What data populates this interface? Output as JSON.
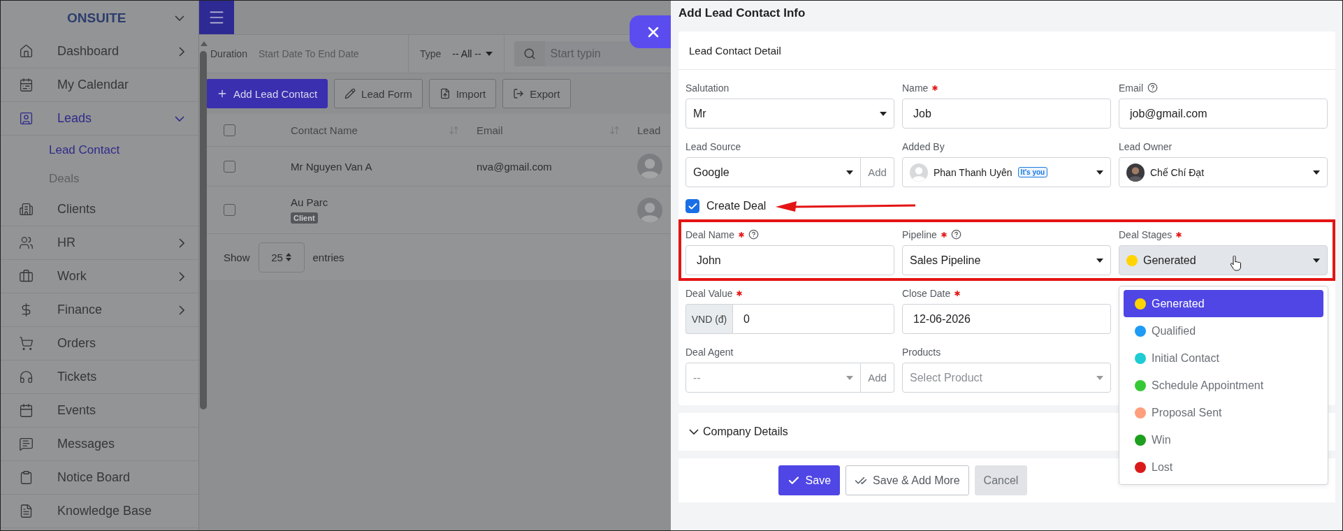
{
  "sidebar": {
    "brand": "ONSUITE",
    "items": [
      {
        "label": "Dashboard",
        "kind": "menu",
        "expanded": false,
        "selected": false
      },
      {
        "label": "My Calendar",
        "kind": "link",
        "selected": false
      },
      {
        "label": "Leads",
        "kind": "menu",
        "expanded": true,
        "selected": true,
        "children": [
          {
            "label": "Lead Contact",
            "selected": true
          },
          {
            "label": "Deals",
            "selected": false
          }
        ]
      },
      {
        "label": "Clients",
        "kind": "link",
        "selected": false
      },
      {
        "label": "HR",
        "kind": "menu",
        "expanded": false,
        "selected": false
      },
      {
        "label": "Work",
        "kind": "menu",
        "expanded": false,
        "selected": false
      },
      {
        "label": "Finance",
        "kind": "menu",
        "expanded": false,
        "selected": false
      },
      {
        "label": "Orders",
        "kind": "link",
        "selected": false
      },
      {
        "label": "Tickets",
        "kind": "link",
        "selected": false
      },
      {
        "label": "Events",
        "kind": "link",
        "selected": false
      },
      {
        "label": "Messages",
        "kind": "link",
        "selected": false
      },
      {
        "label": "Notice Board",
        "kind": "link",
        "selected": false
      },
      {
        "label": "Knowledge Base",
        "kind": "link",
        "selected": false
      }
    ]
  },
  "filters": {
    "duration_label": "Duration",
    "date_placeholder": "Start Date To End Date",
    "type_label": "Type",
    "type_value": "-- All --",
    "search_placeholder": "Start typin"
  },
  "toolbar": [
    {
      "label": "Add Lead Contact",
      "kind": "primary"
    },
    {
      "label": "Lead Form",
      "kind": "outline"
    },
    {
      "label": "Import",
      "kind": "outline"
    },
    {
      "label": "Export",
      "kind": "outline"
    }
  ],
  "table": {
    "all_checked": false,
    "columns": [
      "Contact Name",
      "Email",
      "Lead"
    ],
    "rows": [
      {
        "name": "Mr Nguyen Van A",
        "email": "nva@gmail.com",
        "checked": false
      },
      {
        "name": "Au Parc",
        "badge": "Client",
        "checked": false
      }
    ],
    "footer": {
      "show": "Show",
      "page_size": "25",
      "entries": "entries"
    }
  },
  "panel": {
    "title": "Add Lead Contact Info",
    "section": "Lead Contact Detail",
    "rows": [
      {
        "fields": [
          {
            "kind": "select",
            "label": "Salutation",
            "value": "Mr",
            "required": false,
            "help": false
          },
          {
            "kind": "text",
            "label": "Name",
            "value": "Job",
            "required": true,
            "help": false
          },
          {
            "kind": "text",
            "label": "Email",
            "value": "job@gmail.com",
            "required": false,
            "help": true
          }
        ]
      },
      {
        "fields": [
          {
            "kind": "select_add",
            "label": "Lead Source",
            "value": "Google",
            "button": "Add",
            "required": false,
            "help": false
          },
          {
            "kind": "user_select",
            "label": "Added By",
            "value": "Phan Thanh Uyên",
            "badge": "It's you",
            "required": false,
            "help": false
          },
          {
            "kind": "user_select",
            "label": "Lead Owner",
            "value": "Chế Chí Đạt",
            "required": false,
            "help": false
          }
        ]
      }
    ],
    "create_deal": {
      "label": "Create Deal",
      "checked": true
    },
    "deal_rows": [
      {
        "fields": [
          {
            "kind": "text",
            "label": "Deal Name",
            "value": "John",
            "required": true,
            "help": true
          },
          {
            "kind": "select",
            "label": "Pipeline",
            "value": "Sales Pipeline",
            "required": true,
            "help": true
          },
          {
            "kind": "stage_select",
            "label": "Deal Stages",
            "value": "Generated",
            "color": "#ffd400",
            "required": true,
            "help": false,
            "expanded": true,
            "options": [
              {
                "label": "Generated",
                "color": "#ffd400",
                "selected": true
              },
              {
                "label": "Qualified",
                "color": "#1e9bf5",
                "selected": false
              },
              {
                "label": "Initial Contact",
                "color": "#1fccd3",
                "selected": false
              },
              {
                "label": "Schedule Appointment",
                "color": "#37c837",
                "selected": false
              },
              {
                "label": "Proposal Sent",
                "color": "#ff9f7d",
                "selected": false
              },
              {
                "label": "Win",
                "color": "#1f9f1f",
                "selected": false
              },
              {
                "label": "Lost",
                "color": "#da1a1a",
                "selected": false
              }
            ]
          }
        ]
      },
      {
        "fields": [
          {
            "kind": "currency",
            "label": "Deal Value",
            "prefix": "VND (đ)",
            "value": "0",
            "required": true,
            "help": false
          },
          {
            "kind": "text",
            "label": "Close Date",
            "value": "12-06-2026",
            "required": true,
            "help": false
          }
        ]
      },
      {
        "fields": [
          {
            "kind": "select_add",
            "label": "Deal Agent",
            "placeholder": "--",
            "button": "Add",
            "required": false,
            "help": false
          },
          {
            "kind": "select",
            "label": "Products",
            "placeholder": "Select Product",
            "required": false,
            "help": false
          }
        ]
      }
    ],
    "company": {
      "title": "Company Details",
      "expanded": false
    },
    "buttons": [
      {
        "label": "Save",
        "kind": "primary"
      },
      {
        "label": "Save & Add More",
        "kind": "outline"
      },
      {
        "label": "Cancel",
        "kind": "secondary"
      }
    ]
  }
}
